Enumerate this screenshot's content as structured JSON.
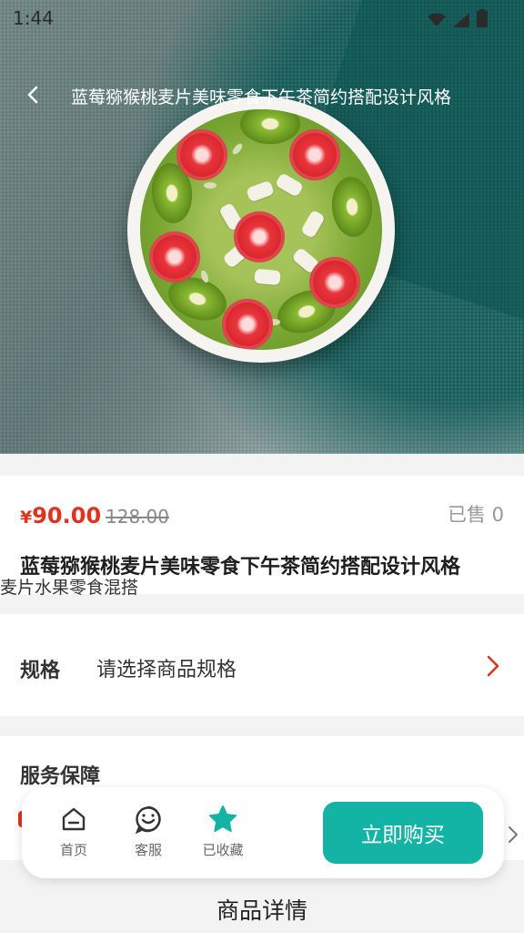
{
  "status_bar": {
    "time": "1:44",
    "icons": [
      "wifi-icon",
      "signal-icon",
      "battery-icon"
    ]
  },
  "nav": {
    "back_icon": "chevron-left-icon",
    "title": "蓝莓猕猴桃麦片美味零食下午茶简约搭配设计风格"
  },
  "product": {
    "price_symbol": "¥",
    "price": "90.00",
    "original_price": "128.00",
    "sold": "已售 0",
    "title": "蓝莓猕猴桃麦片美味零食下午茶简约搭配设计风格",
    "subtitle": "麦片水果零食混搭"
  },
  "spec": {
    "label": "规格",
    "value": "请选择商品规格",
    "arrow_icon": "chevron-right-icon"
  },
  "service": {
    "title": "服务保障"
  },
  "detail": {
    "title": "商品详情"
  },
  "bottom_bar": {
    "tabs": [
      {
        "label": "首页",
        "icon": "home-icon"
      },
      {
        "label": "客服",
        "icon": "customer-service-icon"
      },
      {
        "label": "已收藏",
        "icon": "star-icon"
      }
    ],
    "buy_label": "立即购买"
  },
  "colors": {
    "accent": "#13b3a5",
    "price": "#e0321e",
    "arrow": "#d9381e"
  }
}
